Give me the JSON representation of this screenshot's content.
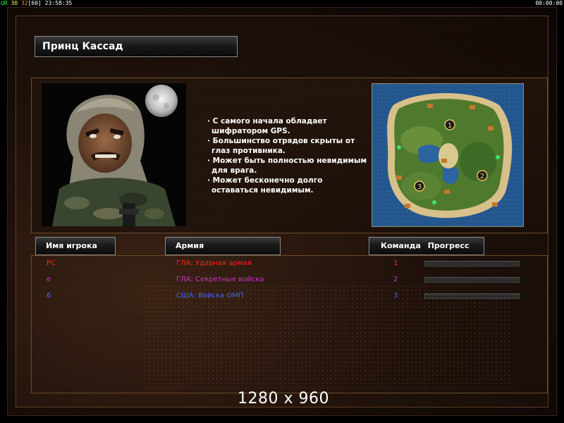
{
  "hud": {
    "fps_a": "UR",
    "fps_b": "30",
    "fps_c": "32",
    "fps_d": "[60]",
    "time": "23:58:35",
    "timer": "00:00:00"
  },
  "general": {
    "name": "Принц Кассад",
    "description": [
      "· С самого начала обладает",
      "шифратором GPS.",
      "· Большинство отрядов скрыты от",
      "глаз противника.",
      "· Может быть полностью невидимым",
      "для врага.",
      "· Может бесконечно долго",
      "оставаться невидимым."
    ]
  },
  "minimap": {
    "start_positions": [
      "1",
      "2",
      "3"
    ]
  },
  "table": {
    "headers": {
      "name": "Имя игрока",
      "army": "Армия",
      "team": "Команда",
      "progress": "Прогресс"
    },
    "rows": [
      {
        "name": "PC",
        "army": "ГЛА: Ударная армия",
        "team": "1",
        "color": "#ff2020"
      },
      {
        "name": "e",
        "army": "ГЛА: Секретные войска",
        "team": "2",
        "color": "#cc33cc"
      },
      {
        "name": "6",
        "army": "США: Войска ОМП",
        "team": "3",
        "color": "#4466ff"
      }
    ]
  },
  "watermark": "1280 x 960",
  "colors": {
    "accent_border": "#8a8a8a",
    "panel_border": "#6a4c2a"
  }
}
